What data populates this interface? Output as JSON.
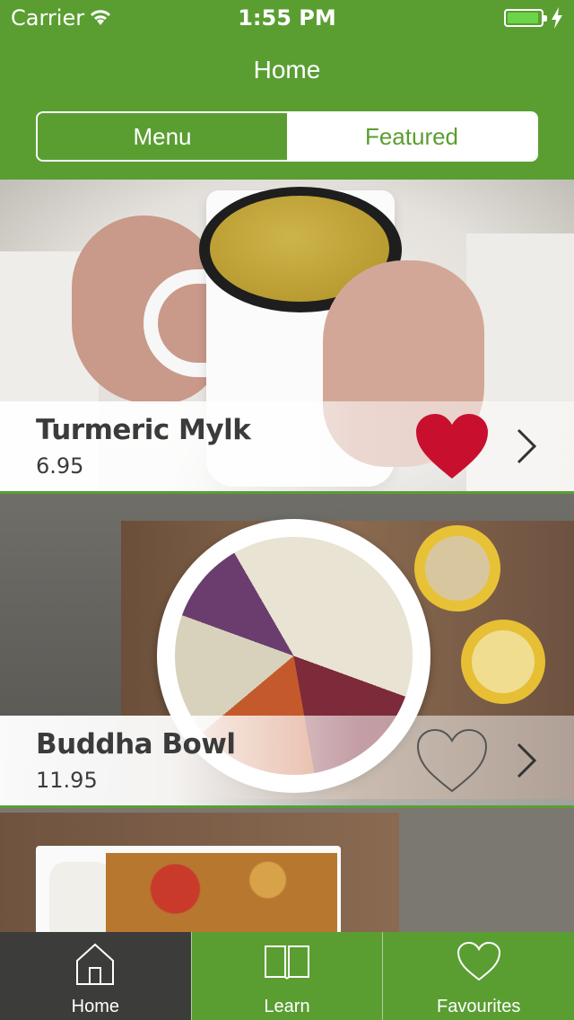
{
  "status_bar": {
    "carrier": "Carrier",
    "time": "1:55 PM"
  },
  "nav": {
    "title": "Home"
  },
  "segmented": {
    "options": [
      "Menu",
      "Featured"
    ],
    "selected": "Menu"
  },
  "items": [
    {
      "name": "Turmeric Mylk",
      "price": "6.95",
      "favourite": true
    },
    {
      "name": "Buddha Bowl",
      "price": "11.95",
      "favourite": false
    }
  ],
  "tab_bar": {
    "tabs": [
      {
        "label": "Home",
        "icon": "house-icon",
        "active": true
      },
      {
        "label": "Learn",
        "icon": "book-icon",
        "active": false
      },
      {
        "label": "Favourites",
        "icon": "heart-outline-icon",
        "active": false
      }
    ]
  },
  "colors": {
    "brand_green": "#5a9e32",
    "favourite_red": "#c8102e",
    "tab_active_bg": "#3c3c3a"
  }
}
